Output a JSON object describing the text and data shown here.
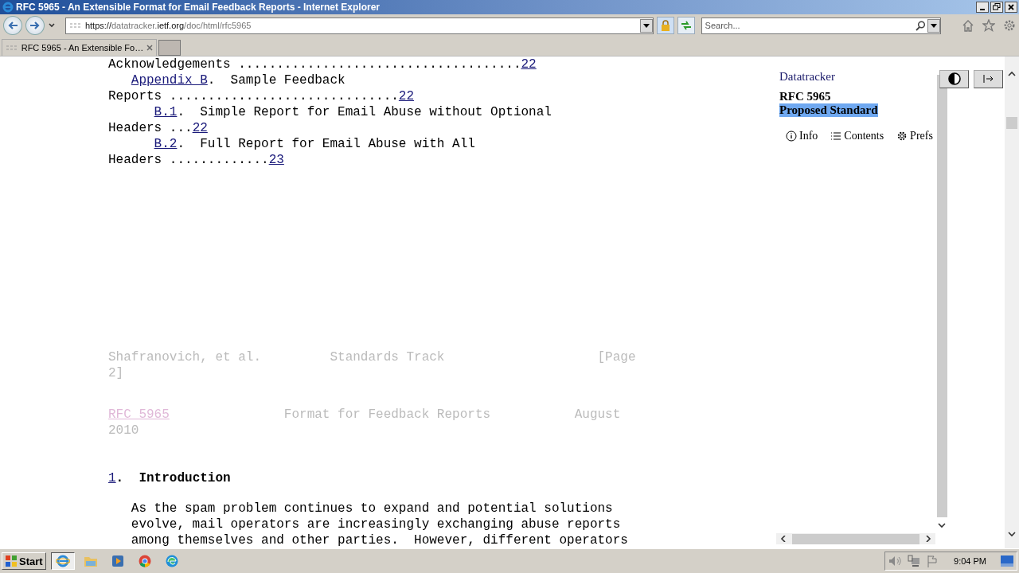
{
  "window": {
    "title": "RFC 5965 - An Extensible Format for Email Feedback Reports - Internet Explorer"
  },
  "address_bar": {
    "url_parts": [
      {
        "text": "https://",
        "strong": true
      },
      {
        "text": "datatracker.",
        "strong": false
      },
      {
        "text": "ietf.org",
        "strong": true
      },
      {
        "text": "/doc/html/rfc5965",
        "strong": false
      }
    ]
  },
  "search": {
    "placeholder": "Search..."
  },
  "tabs": [
    {
      "label": "RFC 5965 - An Extensible Fo…",
      "selected": true
    }
  ],
  "document": {
    "blocks": [
      {
        "kind": "toc",
        "lines": [
          {
            "kind": "flush",
            "segments": [
              {
                "text": "Acknowledgements .....................................",
                "link": false
              },
              {
                "text": "22",
                "link": true
              }
            ]
          },
          {
            "kind": "indent",
            "segments": [
              {
                "text": "Appendix B",
                "link": true
              },
              {
                "text": ".  Sample Feedback",
                "link": false
              }
            ]
          },
          {
            "kind": "flush",
            "segments": [
              {
                "text": "Reports ..............................",
                "link": false
              },
              {
                "text": "22",
                "link": true
              }
            ]
          },
          {
            "kind": "subindent",
            "segments": [
              {
                "text": "B.1",
                "link": true
              },
              {
                "text": ".  Simple Report for Email Abuse without Optional",
                "link": false
              }
            ]
          },
          {
            "kind": "flush",
            "segments": [
              {
                "text": "Headers ...",
                "link": false
              },
              {
                "text": "22",
                "link": true
              }
            ]
          },
          {
            "kind": "subindent",
            "segments": [
              {
                "text": "B.2",
                "link": true
              },
              {
                "text": ".  Full Report for Email Abuse with All",
                "link": false
              }
            ]
          },
          {
            "kind": "flush",
            "segments": [
              {
                "text": "Headers .............",
                "link": false
              },
              {
                "text": "23",
                "link": true
              }
            ]
          }
        ]
      },
      {
        "kind": "footer",
        "lines": [
          {
            "kind": "flush",
            "segments": [
              {
                "text": "Shafranovich, et al.         Standards Track                    [Page",
                "link": false
              }
            ]
          },
          {
            "kind": "flush",
            "segments": [
              {
                "text": "2]",
                "link": false
              }
            ]
          }
        ]
      },
      {
        "kind": "header",
        "lines": [
          {
            "kind": "flush",
            "segments": [
              {
                "text": "RFC 5965",
                "link": true
              },
              {
                "text": "               Format for Feedback Reports           August",
                "link": false
              }
            ]
          },
          {
            "kind": "flush",
            "segments": [
              {
                "text": "2010",
                "link": false
              }
            ]
          }
        ]
      },
      {
        "kind": "heading",
        "lines": [
          {
            "kind": "flush",
            "segments": [
              {
                "text": "1",
                "link": true
              },
              {
                "text": ".  Introduction",
                "link": false
              }
            ]
          }
        ]
      },
      {
        "kind": "paragraph",
        "lines": [
          {
            "kind": "indent",
            "segments": [
              {
                "text": "As the spam problem continues to expand and potential solutions",
                "link": false
              }
            ]
          },
          {
            "kind": "indent",
            "segments": [
              {
                "text": "evolve, mail operators are increasingly exchanging abuse reports",
                "link": false
              }
            ]
          },
          {
            "kind": "indent",
            "segments": [
              {
                "text": "among themselves and other parties.  However, different operators",
                "link": false
              }
            ]
          }
        ]
      }
    ]
  },
  "sidebar": {
    "site": "Datatracker",
    "doc_name": "RFC 5965",
    "status": {
      "text": "Proposed Standard",
      "selected": true
    },
    "nav": [
      {
        "kind": "info",
        "label": "Info"
      },
      {
        "kind": "contents",
        "label": "Contents"
      },
      {
        "kind": "prefs",
        "label": "Prefs"
      }
    ]
  },
  "taskbar": {
    "start": "Start",
    "apps": [
      {
        "kind": "ie",
        "selected": true
      },
      {
        "kind": "explorer",
        "selected": false
      },
      {
        "kind": "media",
        "selected": false
      },
      {
        "kind": "chrome",
        "selected": false
      },
      {
        "kind": "edge",
        "selected": false
      }
    ],
    "clock": "9:04 PM"
  }
}
